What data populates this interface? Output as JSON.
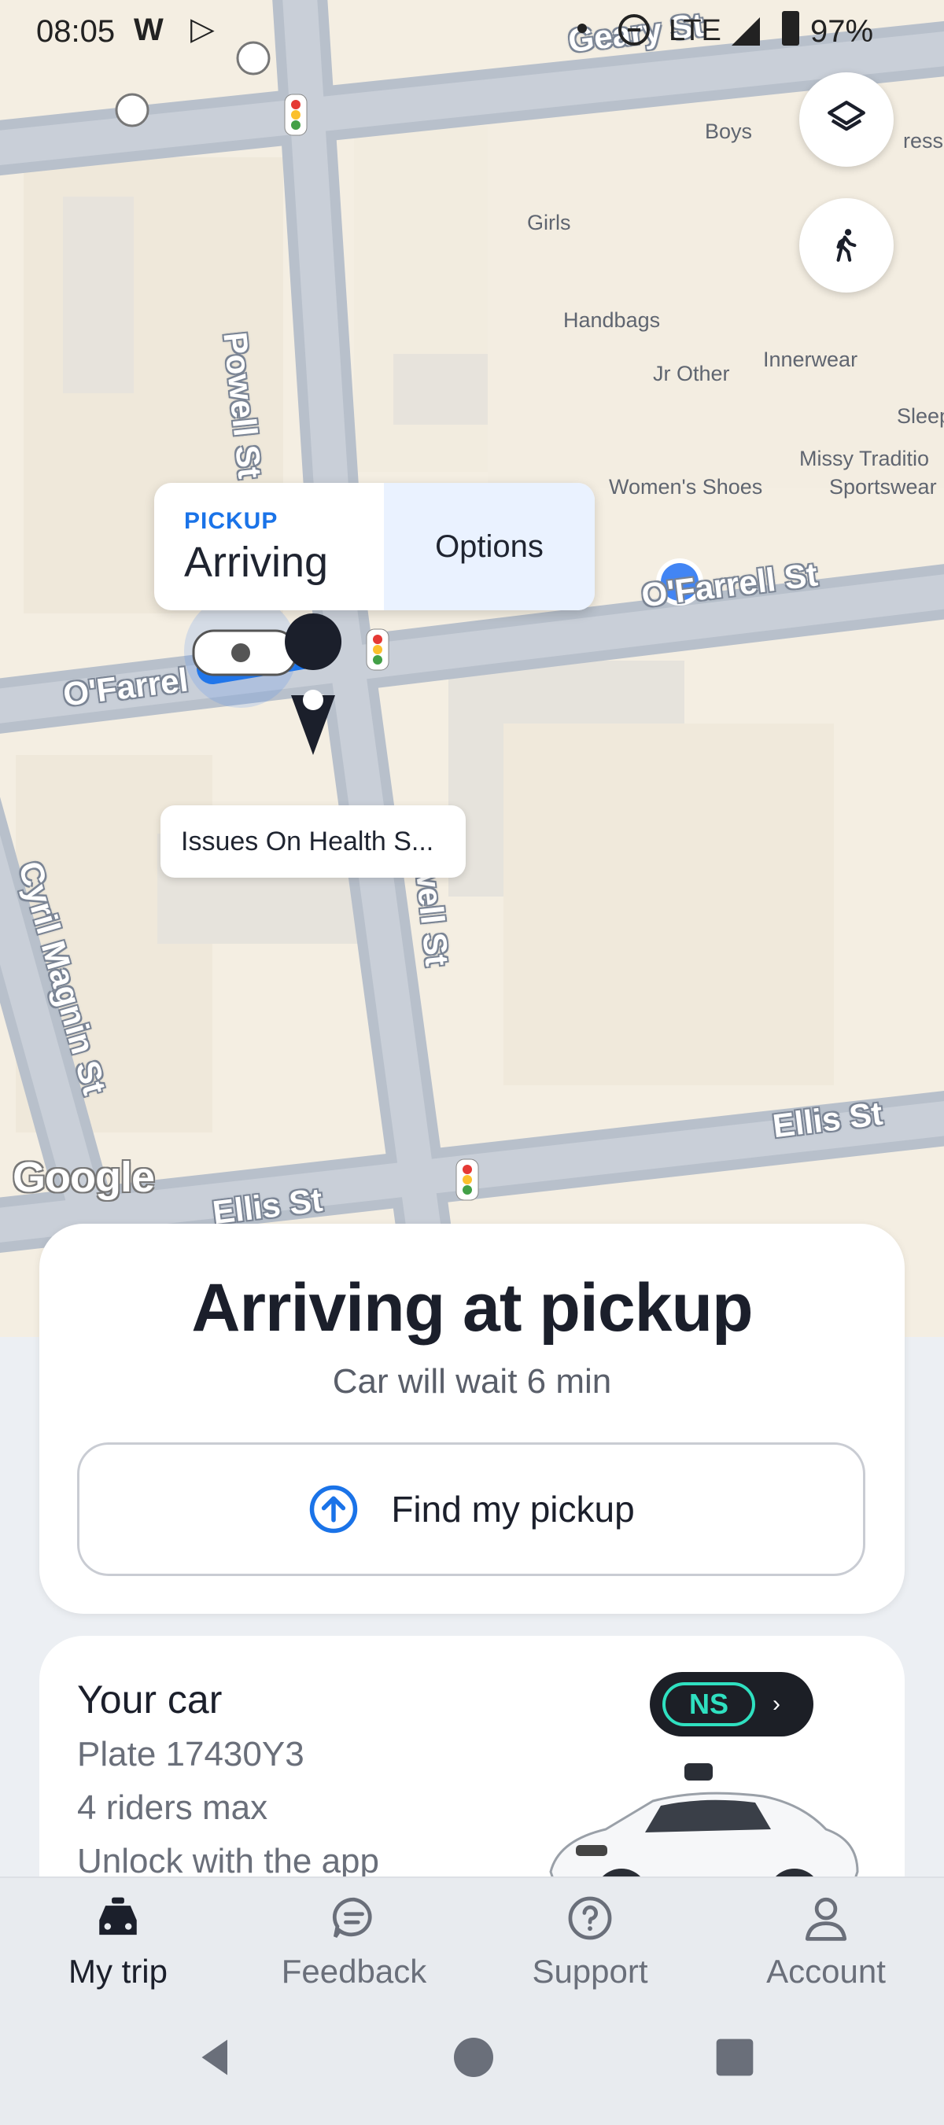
{
  "status_bar": {
    "time": "08:05",
    "w_icon": "W",
    "network": "LTE",
    "battery": "97%"
  },
  "map": {
    "streets": {
      "geary": "Geary St",
      "powell_north": "Powell St",
      "powell_south": "Powell St",
      "ofarrell_east": "O'Farrell St",
      "ofarrell_west": "O'Farrel",
      "ellis_east": "Ellis St",
      "ellis_west": "Ellis St",
      "cyril_magnin": "Cyril Magnin St"
    },
    "pois": [
      "Boys",
      "Girls",
      "Handbags",
      "Jr Other",
      "Innerwear",
      "Sleep",
      "Missy Traditio",
      "Sportswear",
      "Women's Shoes",
      "resse"
    ],
    "attribution": "Google",
    "pickup_bubble": {
      "eyebrow": "PICKUP",
      "status": "Arriving",
      "options": "Options"
    },
    "issue_label": "Issues On Health S..."
  },
  "pickup_card": {
    "title": "Arriving at pickup",
    "subtitle": "Car will wait 6 min",
    "find_button": "Find my pickup"
  },
  "car_card": {
    "heading": "Your car",
    "plate": "Plate 17430Y3",
    "capacity": "4 riders max",
    "unlock": "Unlock with the app",
    "badge": "NS"
  },
  "nav": [
    {
      "label": "My trip",
      "icon": "car-icon",
      "active": true
    },
    {
      "label": "Feedback",
      "icon": "chat-bubble-icon",
      "active": false
    },
    {
      "label": "Support",
      "icon": "help-circle-icon",
      "active": false
    },
    {
      "label": "Account",
      "icon": "person-icon",
      "active": false
    }
  ],
  "colors": {
    "accent": "#1a73e8",
    "badge_teal": "#2fe0c0",
    "ink": "#1b1f2b"
  }
}
